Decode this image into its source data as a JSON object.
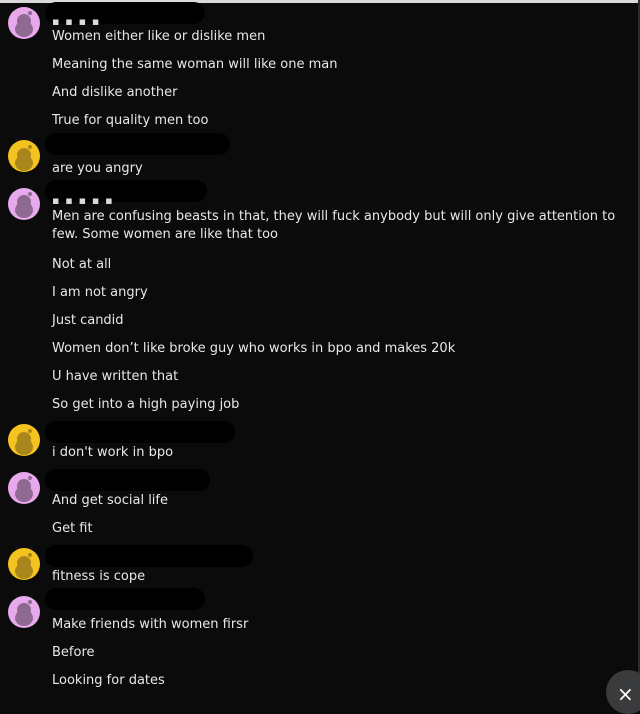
{
  "chat": {
    "messages": [
      {
        "text": "Women either like or dislike men"
      },
      {
        "text": "Meaning the same woman will like one man"
      },
      {
        "text": "And dislike another"
      },
      {
        "text": "True for quality men too"
      },
      {
        "text": "are you angry"
      },
      {
        "text": "Men are confusing beasts in that, they will fuck anybody but will only give attention to few. Some women are like that too"
      },
      {
        "text": "Not at all"
      },
      {
        "text": "I am not angry"
      },
      {
        "text": "Just candid"
      },
      {
        "text": "Women don’t like broke guy who works in bpo and makes 20k"
      },
      {
        "text": "U have written that"
      },
      {
        "text": "So get into a high paying job"
      },
      {
        "text": "i don't work in bpo"
      },
      {
        "text": "And get social life"
      },
      {
        "text": "Get fit"
      },
      {
        "text": "fitness is cope"
      },
      {
        "text": "Make friends with women firsr"
      },
      {
        "text": "Before"
      },
      {
        "text": "Looking for dates"
      }
    ],
    "avatar_colors": {
      "user_a": "#e7a8ec",
      "user_b": "#f4c31f"
    }
  },
  "icons": {
    "close": "×"
  }
}
